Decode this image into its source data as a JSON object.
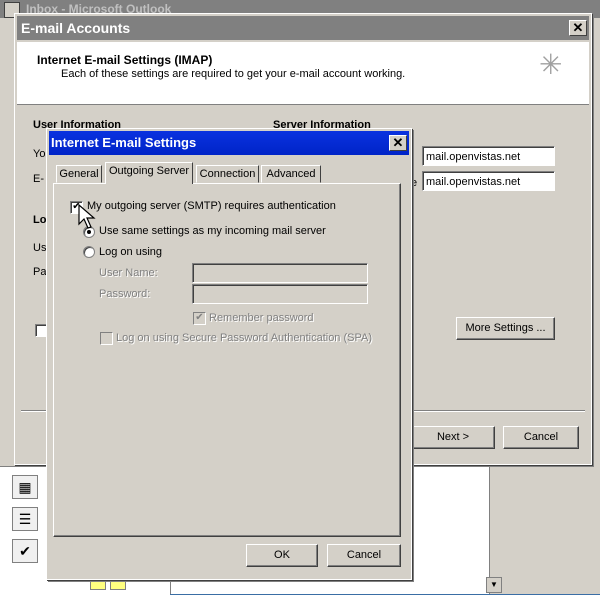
{
  "outlook": {
    "title": "Inbox - Microsoft Outlook"
  },
  "accounts": {
    "title": "E-mail Accounts",
    "heading": "Internet E-mail Settings (IMAP)",
    "subheading": "Each of these settings are required to get your e-mail account working.",
    "user_info_label": "User Information",
    "server_info_label": "Server Information",
    "incoming_server": "mail.openvistas.net",
    "outgoing_server": "mail.openvistas.net",
    "trunc_your": "Yo",
    "trunc_email": "E-",
    "trunc_logon": "Lo",
    "trunc_user": "Us",
    "trunc_pass": "Pa",
    "trunc_server_label": "e",
    "more_settings_label": "More Settings ...",
    "next_label": "Next >",
    "cancel_label": "Cancel"
  },
  "settings": {
    "title": "Internet E-mail Settings",
    "tabs": [
      "General",
      "Outgoing Server",
      "Connection",
      "Advanced"
    ],
    "active_tab": "Outgoing Server",
    "smtp_auth_label": "My outgoing server (SMTP) requires authentication",
    "smtp_auth_checked": true,
    "same_settings_label": "Use same settings as my incoming mail server",
    "logon_using_label": "Log on using",
    "user_name_label": "User Name:",
    "password_label": "Password:",
    "remember_password_label": "Remember password",
    "spa_label": "Log on using Secure Password Authentication (SPA)",
    "ok_label": "OK",
    "cancel_label": "Cancel"
  }
}
